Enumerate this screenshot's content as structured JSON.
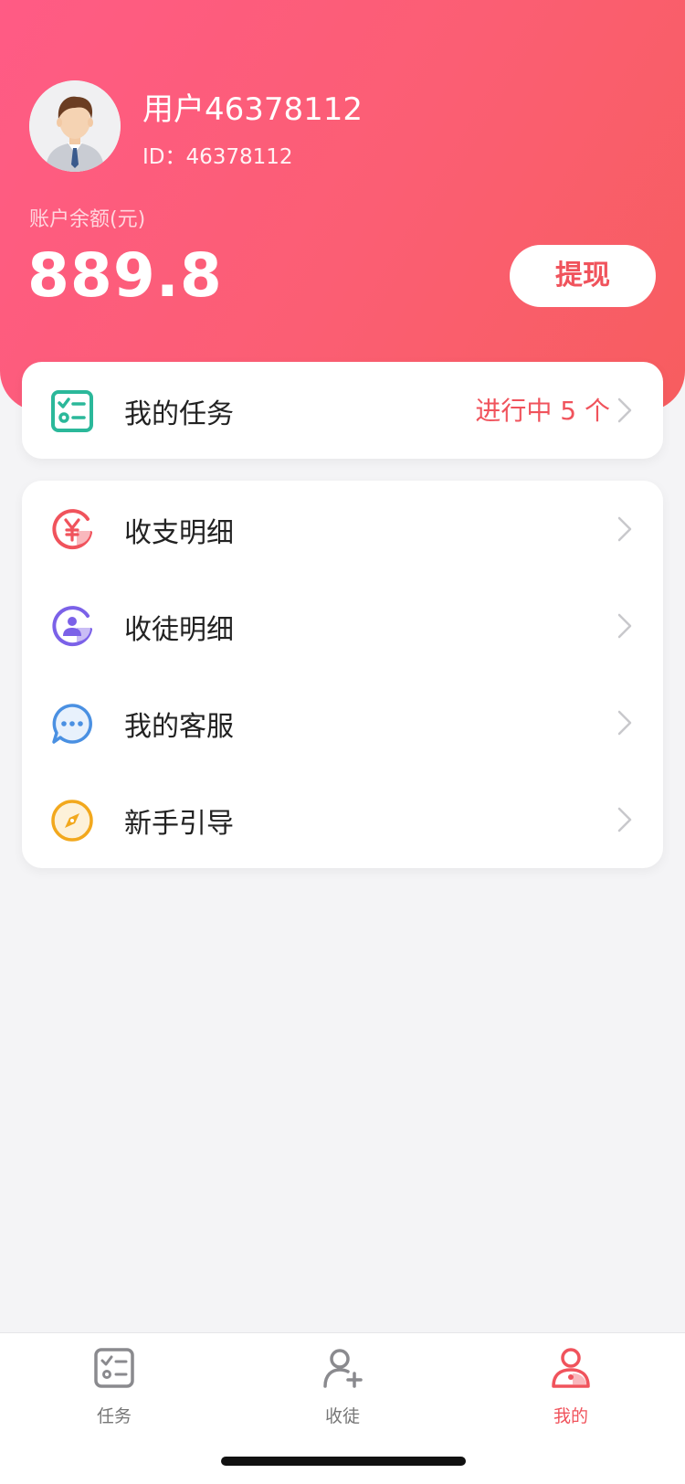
{
  "profile": {
    "username": "用户46378112",
    "id_text": "ID：46378112",
    "balance_label": "账户余额(元)",
    "balance": "889.8",
    "withdraw_label": "提现"
  },
  "task_card": {
    "label": "我的任务",
    "status": "进行中 5 个",
    "icon": "task-list-icon"
  },
  "menu": [
    {
      "label": "收支明细",
      "icon": "yuan-coin-icon",
      "color": "#f0535c"
    },
    {
      "label": "收徒明细",
      "icon": "user-refresh-icon",
      "color": "#7b61e8"
    },
    {
      "label": "我的客服",
      "icon": "chat-bubble-icon",
      "color": "#4a90e2"
    },
    {
      "label": "新手引导",
      "icon": "compass-icon",
      "color": "#f2a81d"
    }
  ],
  "tabbar": {
    "tabs": [
      {
        "label": "任务",
        "icon": "task-list-icon",
        "active": false
      },
      {
        "label": "收徒",
        "icon": "add-user-icon",
        "active": false
      },
      {
        "label": "我的",
        "icon": "profile-icon",
        "active": true
      }
    ]
  },
  "colors": {
    "accent": "#f0535c",
    "header_gradient": [
      "#ff5b85",
      "#f75d5f"
    ],
    "task_icon": "#2bb89a"
  }
}
